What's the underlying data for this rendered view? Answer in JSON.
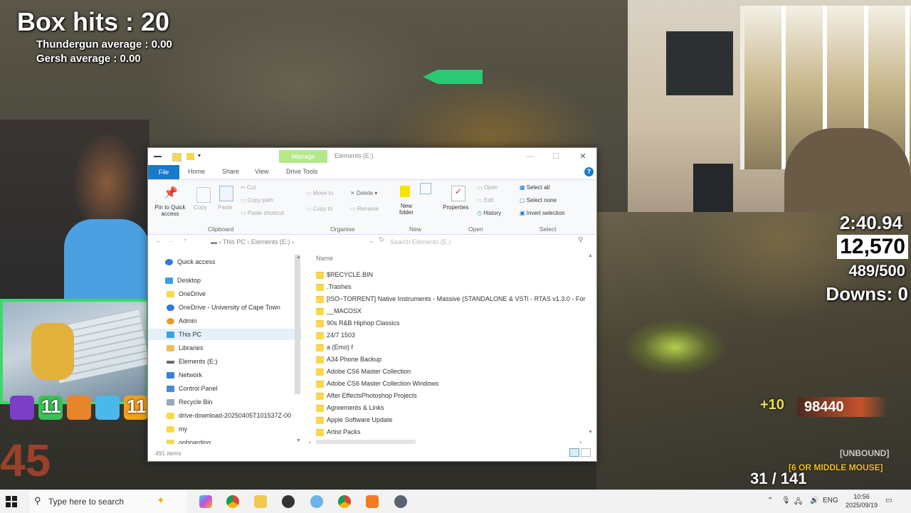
{
  "hud": {
    "box_hits": "Box hits : 20",
    "thundergun": "Thundergun average : 0.00",
    "gersh": "Gersh average : 0.00",
    "perk_count_1": "11",
    "perk_count_2": "11",
    "round": "45",
    "timer": "2:40.94",
    "score": "12,570",
    "target": "489/500",
    "downs": "Downs: 0",
    "plus_points": "+10",
    "points": "98440",
    "unbound": "[UNBOUND]",
    "middle_mouse": "[6 OR MIDDLE MOUSE]",
    "ammo": "31 / 141"
  },
  "explorer": {
    "manage_tab": "Manage",
    "title": "Elements (E:)",
    "tabs": [
      "File",
      "Home",
      "Share",
      "View",
      "Drive Tools"
    ],
    "help_icon": "?",
    "ribbon": {
      "pin": "Pin to Quick access",
      "copy": "Copy",
      "paste": "Paste",
      "cut": "Cut",
      "copy_path": "Copy path",
      "paste_shortcut": "Paste shortcut",
      "move_to": "Move to",
      "copy_to": "Copy to",
      "delete": "Delete",
      "rename": "Rename",
      "new_folder": "New folder",
      "properties": "Properties",
      "open": "Open",
      "edit": "Edit",
      "history": "History",
      "select_all": "Select all",
      "select_none": "Select none",
      "invert_selection": "Invert selection",
      "groups": [
        "Clipboard",
        "Organise",
        "New",
        "Open",
        "Select"
      ]
    },
    "address": {
      "this_pc": "This PC",
      "drive": "Elements (E:)",
      "search_placeholder": "Search Elements (E:)"
    },
    "nav": [
      {
        "label": "Quick access",
        "icon": "star-icon"
      },
      {
        "label": "Desktop",
        "icon": "desktop-icon"
      },
      {
        "label": "OneDrive",
        "icon": "folder-icon"
      },
      {
        "label": "OneDrive - University of Cape Town",
        "icon": "cloud-icon"
      },
      {
        "label": "Admin",
        "icon": "user-icon"
      },
      {
        "label": "This PC",
        "icon": "pc-icon"
      },
      {
        "label": "Libraries",
        "icon": "library-icon"
      },
      {
        "label": "Elements (E:)",
        "icon": "drive-icon"
      },
      {
        "label": "Network",
        "icon": "network-icon"
      },
      {
        "label": "Control Panel",
        "icon": "control-panel-icon"
      },
      {
        "label": "Recycle Bin",
        "icon": "recycle-bin-icon"
      },
      {
        "label": "drive-download-20250405T101537Z-00",
        "icon": "folder-icon"
      },
      {
        "label": "my",
        "icon": "folder-icon"
      },
      {
        "label": "onboarding",
        "icon": "folder-icon"
      }
    ],
    "column_name": "Name",
    "files": [
      "$RECYCLE.BIN",
      ".Trashes",
      "[ISO~TORRENT] Native Instruments - Massive (STANDALONE & VSTi - RTAS v1.3.0 - For",
      "__MACOSX",
      "90s R&B Hiphop Classics",
      "24/7 1503",
      "a (Emo) f",
      "A34 Phone Backup",
      "Adobe CS6 Master Collection",
      "Adobe CS6 Master Collection Windows",
      "After EffectsPhotoshop Projects",
      "Agreements & Links",
      "Apple Software Update",
      "Artist Packs"
    ],
    "status": "491 items"
  },
  "taskbar": {
    "search_placeholder": "Type here to search",
    "language": "ENG",
    "time": "10:56",
    "date": "2025/09/19"
  },
  "colors": {
    "accent": "#1979ca",
    "manage": "#b4e88c",
    "folder": "#f7d94a"
  }
}
